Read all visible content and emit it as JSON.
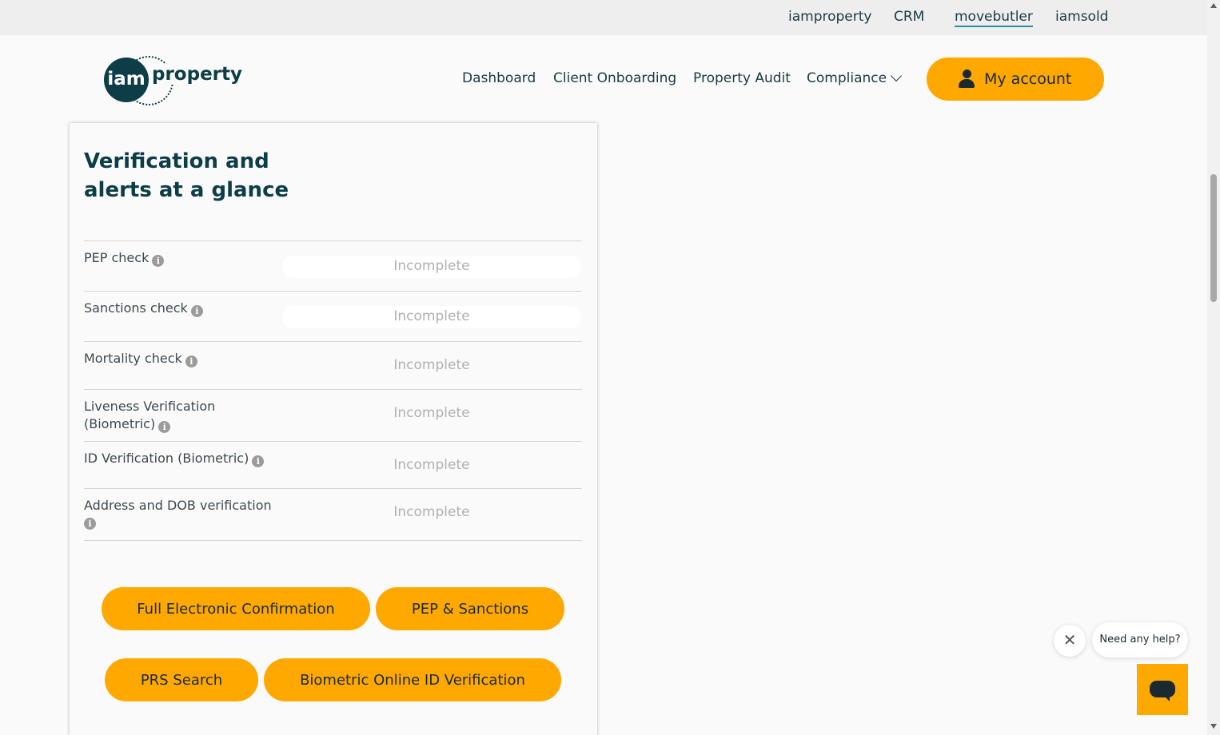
{
  "topbar": {
    "links": [
      "iamproperty",
      "CRM",
      "movebutler",
      "iamsold"
    ],
    "active": "movebutler"
  },
  "header": {
    "logo_mark": "iam",
    "logo_text": "property",
    "nav": [
      "Dashboard",
      "Client Onboarding",
      "Property Audit",
      "Compliance"
    ],
    "account_label": "My account"
  },
  "card": {
    "title": "Verification and alerts at a glance",
    "rows": [
      {
        "label": "PEP check",
        "status": "Incomplete"
      },
      {
        "label": "Sanctions check",
        "status": "Incomplete"
      },
      {
        "label": "Mortality check",
        "status": "Incomplete"
      },
      {
        "label": "Liveness Verification (Biometric)",
        "status": "Incomplete"
      },
      {
        "label": "ID Verification (Biometric)",
        "status": "Incomplete"
      },
      {
        "label": "Address and DOB verification",
        "status": "Incomplete"
      }
    ],
    "actions": [
      "Full Electronic Confirmation",
      "PEP & Sanctions",
      "PRS Search",
      "Biometric Online ID Verification"
    ]
  },
  "chat": {
    "prompt": "Need any help?",
    "close_glyph": "✕"
  },
  "info_glyph": "i",
  "colors": {
    "accent": "#ffa800",
    "brand_dark": "#0d3d46",
    "status_text": "#b0b0b0",
    "link_underline": "#2b8ea3"
  }
}
